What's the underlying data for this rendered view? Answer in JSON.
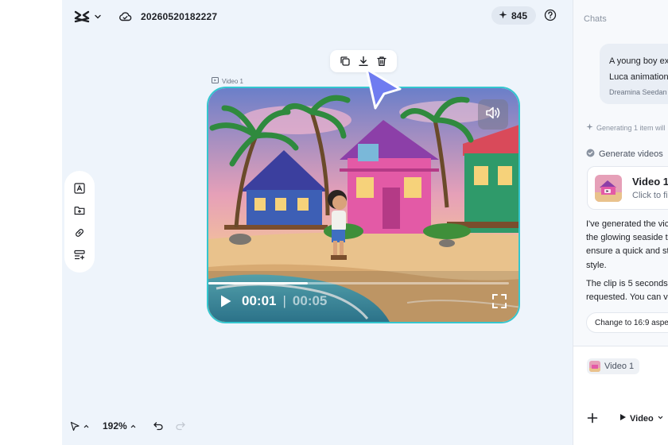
{
  "header": {
    "project_title": "20260520182227",
    "credits": "845",
    "logo_icon": "capcut-logo-icon",
    "cloud_icon": "cloud-icon",
    "help_icon": "help-icon"
  },
  "video_toolbar": {
    "buttons": [
      "duplicate-icon",
      "download-icon",
      "delete-icon"
    ]
  },
  "video": {
    "tag": "Video 1",
    "current_time": "00:01",
    "separator": "|",
    "total_time": "00:05",
    "progress": 0.33,
    "accent_border": "#34c6cf"
  },
  "side_tools": [
    "text-icon",
    "add-folder-icon",
    "link-icon",
    "list-add-icon"
  ],
  "bottom_bar": {
    "zoom": "192%"
  },
  "chat": {
    "title": "Chats",
    "user_message_line1": "A young boy ex",
    "user_message_line2": "Luca animation",
    "user_message_model": "Dreamina Seedan",
    "generating_status": "Generating 1 item will",
    "generate_videos_label": "Generate videos",
    "video_card_name": "Video 1",
    "video_card_sub": "Click to fi",
    "assistant_lines_1": [
      "I've generated the vic",
      "the glowing seaside t",
      "ensure a quick and st",
      "style."
    ],
    "assistant_lines_2": [
      "The clip is 5 seconds",
      "requested. You can v"
    ],
    "suggestion": "Change to 16:9 aspe",
    "attachment_label": "Video 1",
    "mode_label": "Video"
  },
  "colors": {
    "canvas_bg": "#eef4fb",
    "cursor": "#6f7cf0",
    "accent": "#34c6cf"
  }
}
